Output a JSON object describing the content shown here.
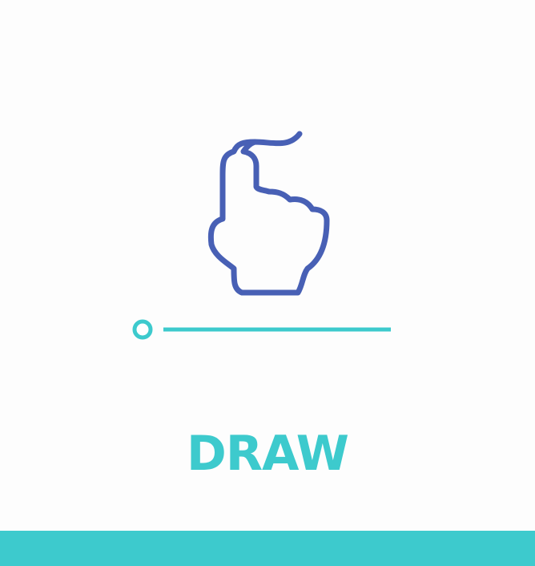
{
  "colors": {
    "accent": "#3dcacd",
    "icon": "#4860b5",
    "background": "#fdfdfd"
  },
  "icon": {
    "name": "hand-pointer-icon"
  },
  "progress": {
    "value": 0
  },
  "label": {
    "text": "DRAW"
  }
}
